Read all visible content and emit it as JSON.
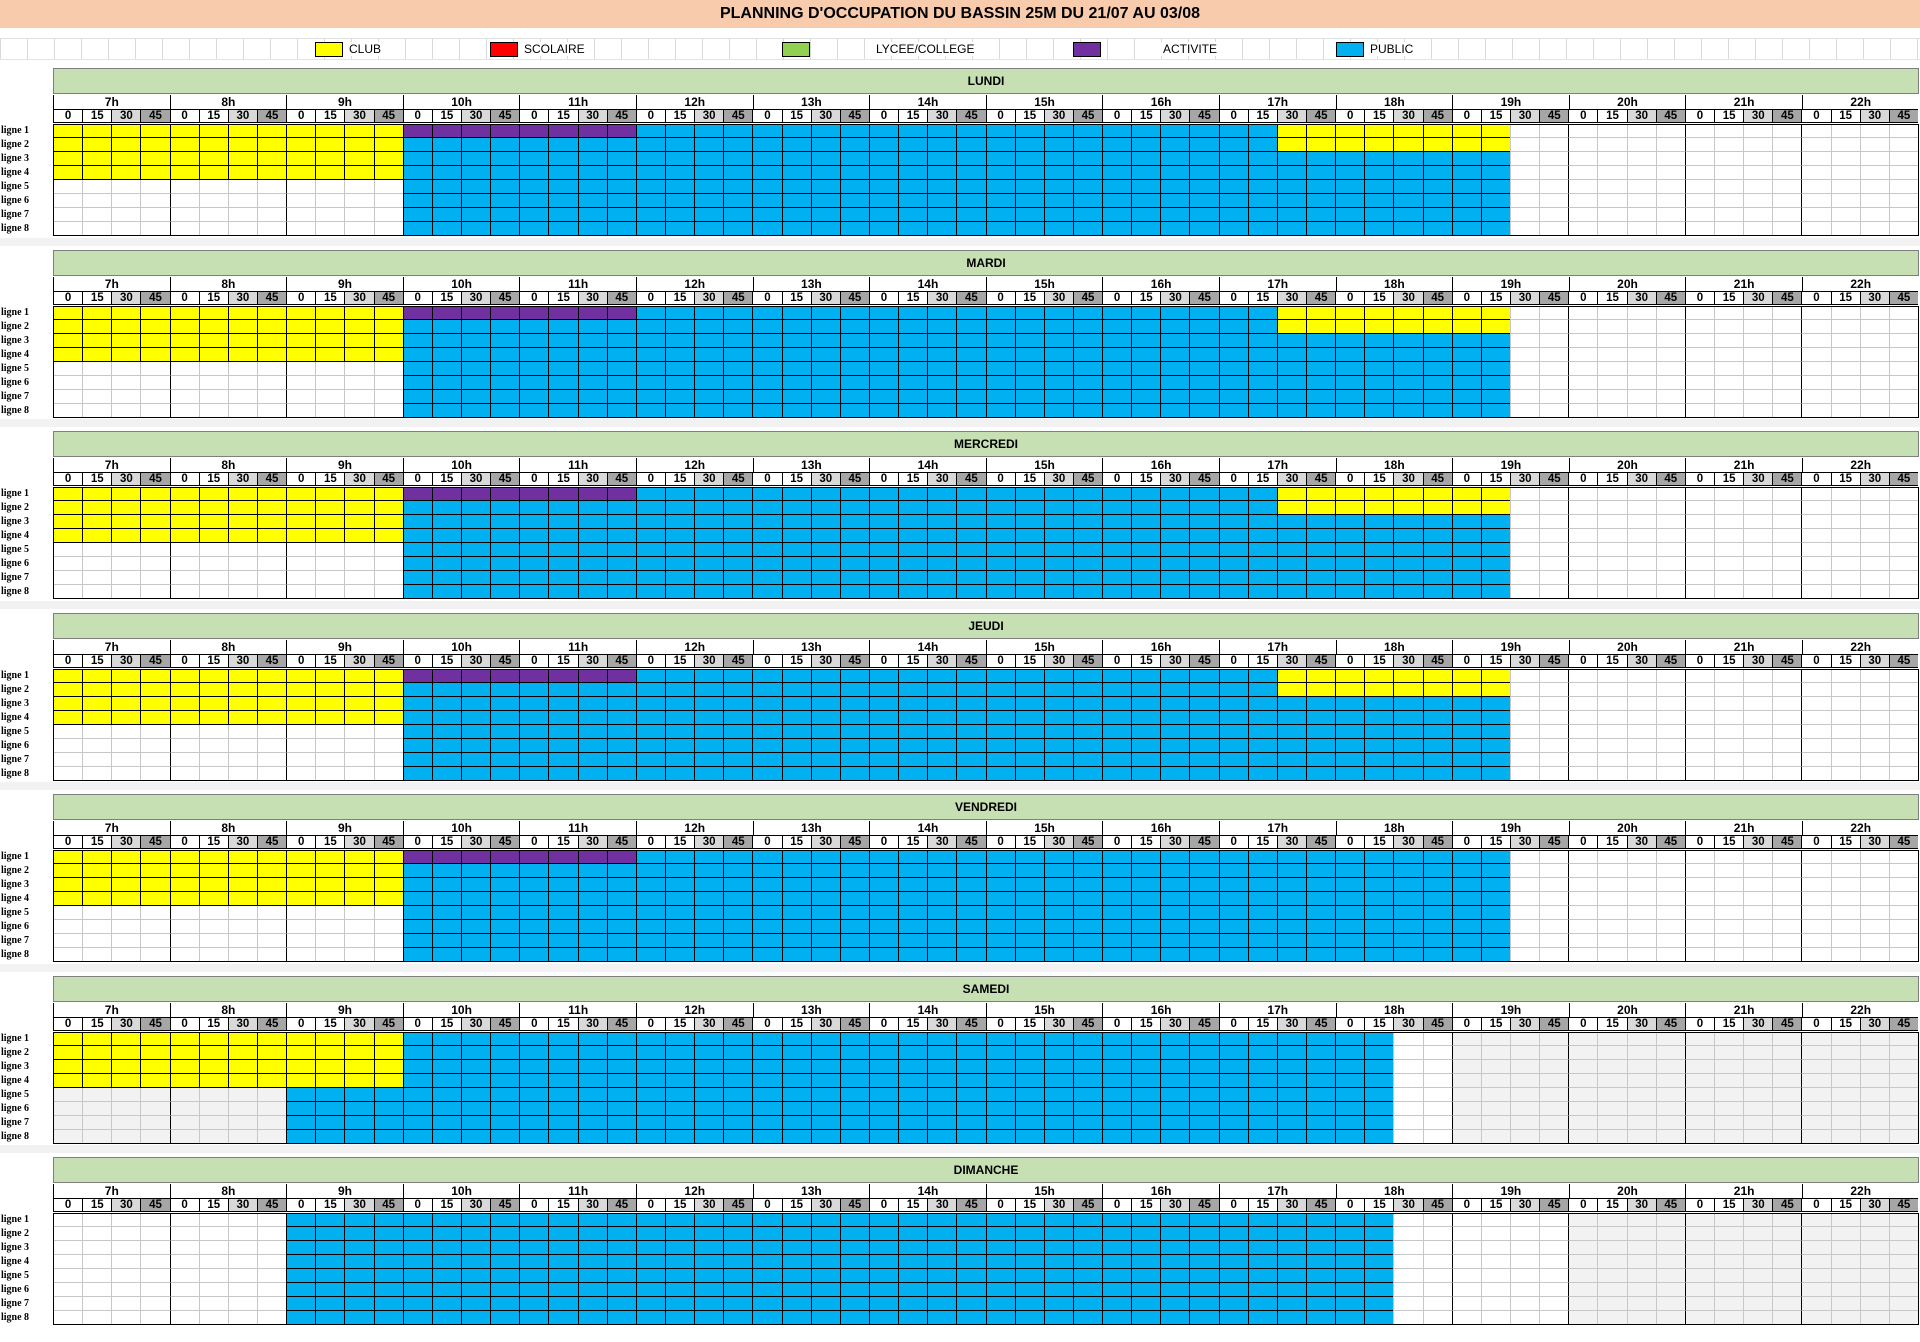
{
  "title": "PLANNING D'OCCUPATION DU BASSIN 25M DU 21/07 AU 03/08",
  "legend": [
    {
      "label": "CLUB",
      "color": "#ffff00"
    },
    {
      "label": "SCOLAIRE",
      "color": "#ff0000"
    },
    {
      "label": "LYCEE/COLLEGE",
      "color": "#92d050"
    },
    {
      "label": "ACTIVITE",
      "color": "#7030a0"
    },
    {
      "label": "PUBLIC",
      "color": "#00b0f0"
    }
  ],
  "hours": [
    "7h",
    "8h",
    "9h",
    "10h",
    "11h",
    "12h",
    "13h",
    "14h",
    "15h",
    "16h",
    "17h",
    "18h",
    "19h",
    "20h",
    "21h",
    "22h"
  ],
  "minutes": [
    "0",
    "15",
    "30",
    "45"
  ],
  "lines": [
    "ligne 1",
    "ligne 2",
    "ligne 3",
    "ligne 4",
    "ligne 5",
    "ligne 6",
    "ligne 7",
    "ligne 8"
  ],
  "colors": {
    "club": "#ffff00",
    "activite": "#7030a0",
    "public": "#00b0f0",
    "empty": "#ffffff",
    "closed": "#f2f2f2"
  },
  "days": [
    {
      "name": "LUNDI",
      "blocks": [
        {
          "type": "club",
          "lines": [
            1,
            2,
            3,
            4
          ],
          "from": "7h00",
          "to": "10h00"
        },
        {
          "type": "activite",
          "lines": [
            1
          ],
          "from": "10h00",
          "to": "12h00"
        },
        {
          "type": "public",
          "lines": [
            2,
            3,
            4,
            5,
            6,
            7,
            8
          ],
          "from": "10h00",
          "to": "12h00"
        },
        {
          "type": "public",
          "lines": [
            1,
            2,
            3,
            4,
            5,
            6,
            7,
            8
          ],
          "from": "12h00",
          "to": "17h30"
        },
        {
          "type": "club",
          "lines": [
            1,
            2
          ],
          "from": "17h30",
          "to": "19h30"
        },
        {
          "type": "public",
          "lines": [
            3,
            4,
            5,
            6,
            7,
            8
          ],
          "from": "17h30",
          "to": "19h30"
        },
        {
          "type": "public",
          "lines": [
            3,
            4,
            5,
            6,
            7,
            8
          ],
          "from": "19h00",
          "to": "19h30"
        }
      ]
    },
    {
      "name": "MARDI",
      "blocks": [
        {
          "type": "club",
          "lines": [
            1,
            2,
            3,
            4
          ],
          "from": "7h00",
          "to": "10h00"
        },
        {
          "type": "activite",
          "lines": [
            1
          ],
          "from": "10h00",
          "to": "12h00"
        },
        {
          "type": "public",
          "lines": [
            2,
            3,
            4,
            5,
            6,
            7,
            8
          ],
          "from": "10h00",
          "to": "12h00"
        },
        {
          "type": "public",
          "lines": [
            1,
            2,
            3,
            4,
            5,
            6,
            7,
            8
          ],
          "from": "12h00",
          "to": "17h30"
        },
        {
          "type": "club",
          "lines": [
            1,
            2
          ],
          "from": "17h30",
          "to": "19h30"
        },
        {
          "type": "public",
          "lines": [
            3,
            4,
            5,
            6,
            7,
            8
          ],
          "from": "17h30",
          "to": "19h30"
        }
      ]
    },
    {
      "name": "MERCREDI",
      "blocks": [
        {
          "type": "club",
          "lines": [
            1,
            2,
            3,
            4
          ],
          "from": "7h00",
          "to": "10h00"
        },
        {
          "type": "activite",
          "lines": [
            1
          ],
          "from": "10h00",
          "to": "12h00"
        },
        {
          "type": "public",
          "lines": [
            2,
            3,
            4,
            5,
            6,
            7,
            8
          ],
          "from": "10h00",
          "to": "12h00"
        },
        {
          "type": "public",
          "lines": [
            1,
            2,
            3,
            4,
            5,
            6,
            7,
            8
          ],
          "from": "12h00",
          "to": "17h30"
        },
        {
          "type": "club",
          "lines": [
            1,
            2
          ],
          "from": "17h30",
          "to": "19h30"
        },
        {
          "type": "public",
          "lines": [
            3,
            4,
            5,
            6,
            7,
            8
          ],
          "from": "17h30",
          "to": "19h30"
        }
      ]
    },
    {
      "name": "JEUDI",
      "blocks": [
        {
          "type": "club",
          "lines": [
            1,
            2,
            3,
            4
          ],
          "from": "7h00",
          "to": "10h00"
        },
        {
          "type": "activite",
          "lines": [
            1
          ],
          "from": "10h00",
          "to": "12h00"
        },
        {
          "type": "public",
          "lines": [
            2,
            3,
            4,
            5,
            6,
            7,
            8
          ],
          "from": "10h00",
          "to": "12h00"
        },
        {
          "type": "public",
          "lines": [
            1,
            2,
            3,
            4,
            5,
            6,
            7,
            8
          ],
          "from": "12h00",
          "to": "17h30"
        },
        {
          "type": "club",
          "lines": [
            1,
            2
          ],
          "from": "17h30",
          "to": "19h30"
        },
        {
          "type": "public",
          "lines": [
            3,
            4,
            5,
            6,
            7,
            8
          ],
          "from": "17h30",
          "to": "19h30"
        }
      ]
    },
    {
      "name": "VENDREDI",
      "blocks": [
        {
          "type": "club",
          "lines": [
            1,
            2,
            3,
            4
          ],
          "from": "7h00",
          "to": "10h00"
        },
        {
          "type": "activite",
          "lines": [
            1
          ],
          "from": "10h00",
          "to": "12h00"
        },
        {
          "type": "public",
          "lines": [
            2,
            3,
            4,
            5,
            6,
            7,
            8
          ],
          "from": "10h00",
          "to": "12h00"
        },
        {
          "type": "public",
          "lines": [
            1,
            2,
            3,
            4,
            5,
            6,
            7,
            8
          ],
          "from": "12h00",
          "to": "19h30"
        }
      ]
    },
    {
      "name": "SAMEDI",
      "blocks": [
        {
          "type": "club",
          "lines": [
            1,
            2,
            3,
            4
          ],
          "from": "7h00",
          "to": "10h00"
        },
        {
          "type": "closed",
          "lines": [
            5,
            6,
            7,
            8
          ],
          "from": "7h00",
          "to": "9h00"
        },
        {
          "type": "public",
          "lines": [
            5,
            6,
            7,
            8
          ],
          "from": "9h00",
          "to": "10h00"
        },
        {
          "type": "public",
          "lines": [
            1,
            2,
            3,
            4,
            5,
            6,
            7,
            8
          ],
          "from": "10h00",
          "to": "18h30"
        },
        {
          "type": "closed",
          "lines": [
            1,
            2,
            3,
            4,
            5,
            6,
            7,
            8
          ],
          "from": "19h00",
          "to": "23h00"
        }
      ]
    },
    {
      "name": "DIMANCHE",
      "blocks": [
        {
          "type": "public",
          "lines": [
            1,
            2,
            3,
            4,
            5,
            6,
            7,
            8
          ],
          "from": "9h00",
          "to": "18h30"
        },
        {
          "type": "closed",
          "lines": [
            1,
            2,
            3,
            4,
            5,
            6,
            7,
            8
          ],
          "from": "20h00",
          "to": "23h00"
        }
      ]
    }
  ]
}
